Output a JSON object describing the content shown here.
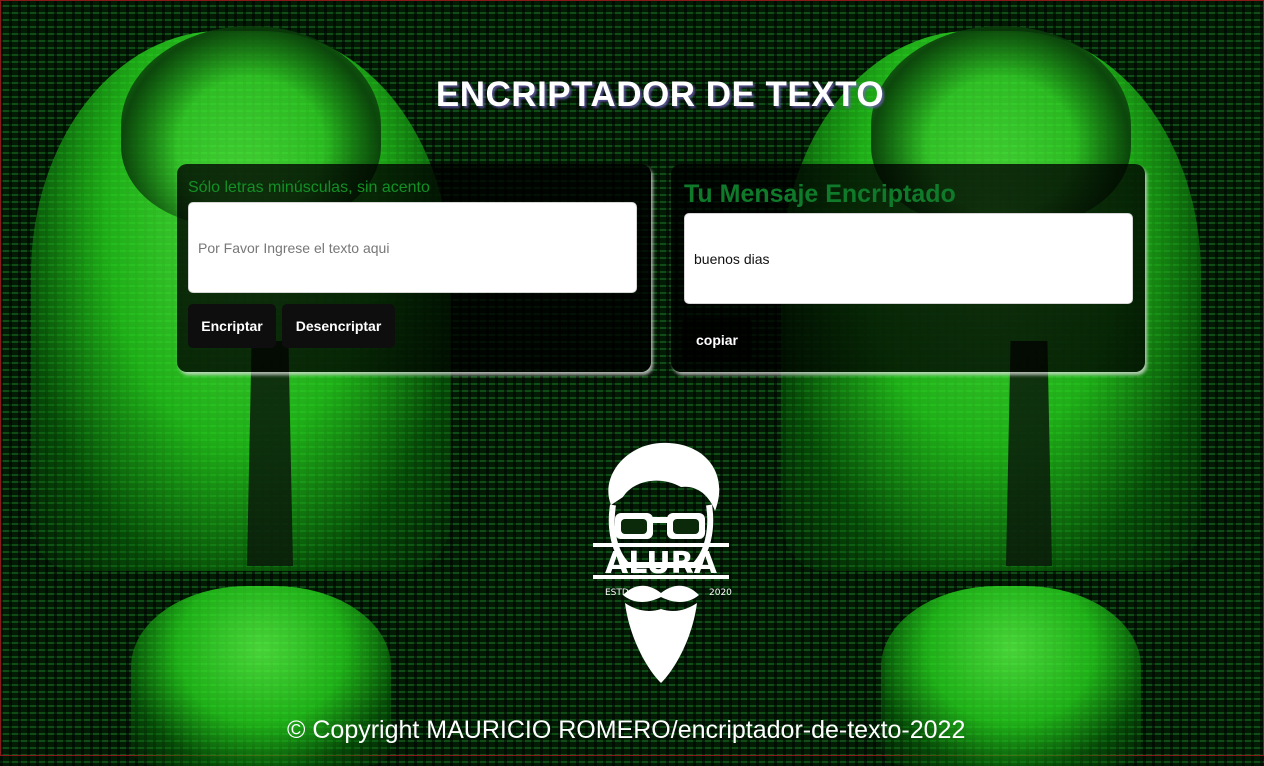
{
  "header": {
    "title": "ENCRIPTADOR DE TEXTO"
  },
  "encrypt_panel": {
    "hint": "Sólo letras minúsculas, sin acento",
    "input_placeholder": "Por Favor Ingrese el texto aqui",
    "encrypt_label": "Encriptar",
    "decrypt_label": "Desencriptar"
  },
  "result_panel": {
    "heading": "Tu Mensaje Encriptado",
    "output_value": "buenos dias",
    "copy_label": "copiar"
  },
  "logo": {
    "icon": "bearded-man-logo",
    "brand": "ALURA",
    "estd": "ESTD",
    "year": "2020"
  },
  "footer": {
    "text": "© Copyright MAURICIO ROMERO/encriptador-de-texto-2022"
  }
}
